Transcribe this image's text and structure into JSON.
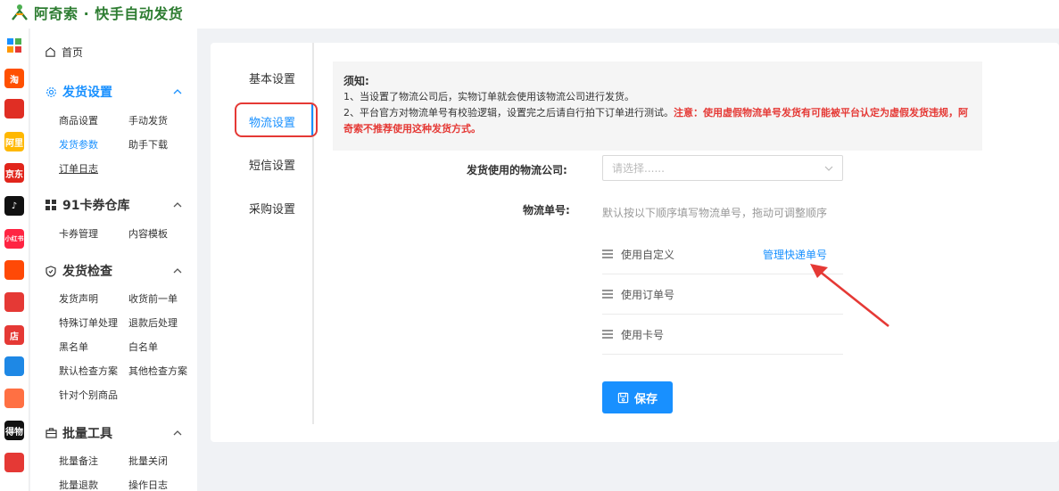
{
  "app": {
    "title": "阿奇索 · 快手自动发货"
  },
  "app_strip": [
    {
      "name": "grid-app-icon",
      "label": "",
      "color": "#ffffff"
    },
    {
      "name": "taobao-app-icon",
      "label": "淘",
      "color": "#ff5000"
    },
    {
      "name": "tmall-app-icon",
      "label": "",
      "color": "#e02e24"
    },
    {
      "name": "yellow-app-icon",
      "label": "阿里",
      "color": "#ffb800"
    },
    {
      "name": "jd-app-icon",
      "label": "京东",
      "color": "#e1251b"
    },
    {
      "name": "douyin-app-icon",
      "label": "♪",
      "color": "#111111"
    },
    {
      "name": "xiaohongshu-app-icon",
      "label": "小红书",
      "color": "#ff2442"
    },
    {
      "name": "kuaishou-app-icon",
      "label": "",
      "color": "#ff4906"
    },
    {
      "name": "thumb-app-icon",
      "label": "",
      "color": "#e53935"
    },
    {
      "name": "store-app-icon",
      "label": "店",
      "color": "#e53935"
    },
    {
      "name": "link-app-icon",
      "label": "",
      "color": "#1e88e5"
    },
    {
      "name": "orange-app-icon",
      "label": "",
      "color": "#ff7043"
    },
    {
      "name": "black-app-icon",
      "label": "得物",
      "color": "#111111"
    },
    {
      "name": "red-shield-app-icon",
      "label": "",
      "color": "#e53935"
    }
  ],
  "sidebar": {
    "home": "首页",
    "groups": [
      {
        "title": "发货设置",
        "items": [
          "商品设置",
          "手动发货",
          "发货参数",
          "助手下载",
          "订单日志"
        ]
      },
      {
        "title": "91卡券仓库",
        "items": [
          "卡券管理",
          "内容模板"
        ]
      },
      {
        "title": "发货检查",
        "items": [
          "发货声明",
          "收货前一单",
          "特殊订单处理",
          "退款后处理",
          "黑名单",
          "白名单",
          "默认检查方案",
          "其他检查方案",
          "针对个别商品"
        ]
      },
      {
        "title": "批量工具",
        "items": [
          "批量备注",
          "批量关闭",
          "批量退款",
          "操作日志"
        ]
      }
    ]
  },
  "tabs": [
    "基本设置",
    "物流设置",
    "短信设置",
    "采购设置"
  ],
  "notice": {
    "title": "须知:",
    "line1": "1、当设置了物流公司后，实物订单就会使用该物流公司进行发货。",
    "line2_normal": "2、平台官方对物流单号有校验逻辑，设置完之后请自行拍下订单进行测试。",
    "line2_red": "注意：使用虚假物流单号发货有可能被平台认定为虚假发货违规，阿奇索不推荐使用这种发货方式。"
  },
  "form": {
    "company_label": "发货使用的物流公司:",
    "company_placeholder": "请选择......",
    "number_label": "物流单号:",
    "number_hint": "默认按以下顺序填写物流单号，拖动可调整顺序",
    "options": [
      "使用自定义",
      "使用订单号",
      "使用卡号"
    ],
    "manage_link": "管理快递单号",
    "save": "保存"
  },
  "colors": {
    "accent": "#1890ff",
    "warning": "#e53935",
    "brand": "#2e7d32"
  }
}
